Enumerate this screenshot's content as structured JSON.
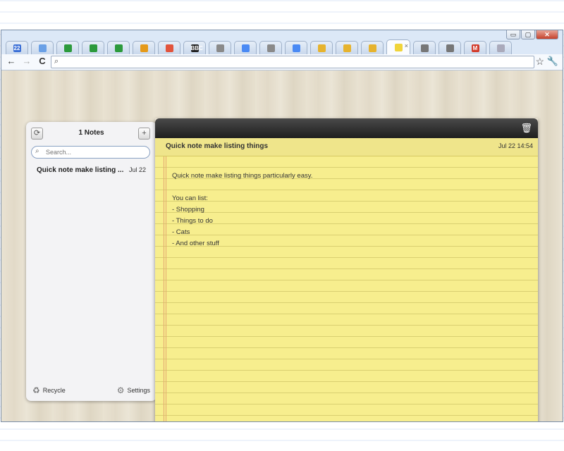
{
  "browser": {
    "window_controls": {
      "minimize": "▭",
      "maximize": "▢",
      "close": "✕"
    },
    "tabs": [
      {
        "icon": "calendar-icon",
        "label": "22",
        "color": "#3b6fd6"
      },
      {
        "icon": "doc-icon",
        "label": "",
        "color": "#6aa0e6"
      },
      {
        "icon": "spreadsheet-icon",
        "label": "",
        "color": "#2c9a3c"
      },
      {
        "icon": "spreadsheet-icon",
        "label": "",
        "color": "#2c9a3c"
      },
      {
        "icon": "spreadsheet-icon",
        "label": "",
        "color": "#2c9a3c"
      },
      {
        "icon": "task-icon",
        "label": "",
        "color": "#e59a1a"
      },
      {
        "icon": "pocket-icon",
        "label": "",
        "color": "#e2543c"
      },
      {
        "icon": "bbc-icon",
        "label": "BBC",
        "color": "#222"
      },
      {
        "icon": "globe-icon",
        "label": "",
        "color": "#8a8a8a"
      },
      {
        "icon": "google-icon",
        "label": "",
        "color": "#4a8af4"
      },
      {
        "icon": "globe-icon",
        "label": "",
        "color": "#8a8a8a"
      },
      {
        "icon": "google-icon",
        "label": "",
        "color": "#4a8af4"
      },
      {
        "icon": "extension-icon",
        "label": "",
        "color": "#e6b32e"
      },
      {
        "icon": "extension-icon",
        "label": "",
        "color": "#e6b32e"
      },
      {
        "icon": "extension-icon",
        "label": "",
        "color": "#e6b32e"
      },
      {
        "icon": "notes-icon",
        "label": "",
        "color": "#f0d43a",
        "active": true
      },
      {
        "icon": "gift-icon",
        "label": "",
        "color": "#777"
      },
      {
        "icon": "gift-icon",
        "label": "",
        "color": "#777"
      },
      {
        "icon": "gmail-icon",
        "label": "M",
        "color": "#d23c2c"
      },
      {
        "icon": "new-tab-icon",
        "label": "",
        "color": "#aab"
      }
    ],
    "tab_close": "×",
    "nav": {
      "back": "←",
      "forward": "→",
      "reload": "C"
    },
    "omnibox": {
      "value": "",
      "search_glyph": "⌕"
    },
    "star": "☆",
    "wrench": "🔧"
  },
  "notes_app": {
    "sidebar": {
      "sync_glyph": "⟳",
      "add_glyph": "+",
      "count_label": "1 Notes",
      "search_placeholder": "Search...",
      "search_glyph": "⌕",
      "notes": [
        {
          "title": "Quick note make listing ...",
          "date": "Jul 22"
        }
      ],
      "footer": {
        "recycle_glyph": "♻",
        "recycle_label": "Recycle",
        "settings_glyph": "⚙",
        "settings_label": "Settings"
      }
    },
    "editor": {
      "trash_glyph": "🗑",
      "title": "Quick note make listing things",
      "date": "Jul 22 14:54",
      "body": "Quick note make listing things particularly easy.\n\nYou can list:\n- Shopping\n- Things to do\n- Cats\n- And other stuff"
    }
  }
}
